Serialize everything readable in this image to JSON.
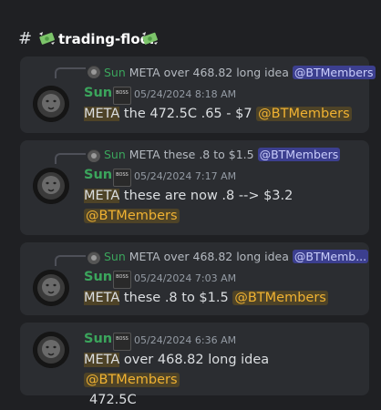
{
  "channel": {
    "hash": "#",
    "name": "trading-floor",
    "icon": "money-with-wings-icon"
  },
  "messages": [
    {
      "reply": {
        "author": "Sun",
        "text": "META over 468.82 long idea",
        "mention": "@BTMembers"
      },
      "author": "Sun",
      "badge": "BOSS",
      "time": "05/24/2024 8:18 AM",
      "ticker": "META",
      "body": " the 472.5C .65 - $7 ",
      "mention": "@BTMembers"
    },
    {
      "reply": {
        "author": "Sun",
        "text": "META these .8 to $1.5",
        "mention": "@BTMembers"
      },
      "author": "Sun",
      "badge": "BOSS",
      "time": "05/24/2024 7:17 AM",
      "ticker": "META",
      "body": " these are now .8 --> $3.2",
      "mention": "@BTMembers"
    },
    {
      "reply": {
        "author": "Sun",
        "text": "META over 468.82 long idea",
        "mention": "@BTMemb..."
      },
      "author": "Sun",
      "badge": "BOSS",
      "time": "05/24/2024 7:03 AM",
      "ticker": "META",
      "body": " these .8 to $1.5 ",
      "mention": "@BTMembers"
    },
    {
      "author": "Sun",
      "badge": "BOSS",
      "time": "05/24/2024 6:36 AM",
      "ticker": "META",
      "body": " over 468.82 long idea ",
      "mention": "@BTMembers",
      "body2": "472.5C"
    }
  ]
}
